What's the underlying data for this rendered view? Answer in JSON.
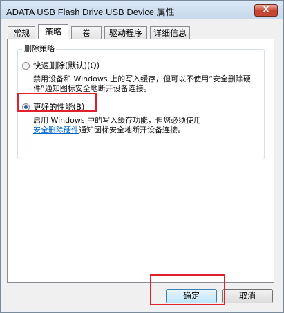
{
  "window": {
    "title": "ADATA USB Flash Drive USB Device 属性",
    "close_label": "X"
  },
  "tabs": [
    {
      "label": "常规",
      "active": false
    },
    {
      "label": "策略",
      "active": true
    },
    {
      "label": "卷",
      "active": false
    },
    {
      "label": "驱动程序",
      "active": false
    },
    {
      "label": "详细信息",
      "active": false
    }
  ],
  "removal_policy": {
    "group_title": "删除策略",
    "quick_removal": {
      "label": "快速删除(默认)(Q)",
      "description": "禁用设备和 Windows 上的写入缓存，但可以不使用“安全删除硬件”通知图标安全地断开设备连接。",
      "selected": false
    },
    "better_performance": {
      "label": "更好的性能(B)",
      "description_before": "启用 Windows 中的写入缓存功能，但您必须使用",
      "link_text": "安全删除硬件",
      "description_after": "通知图标安全地断开设备连接。",
      "selected": true
    }
  },
  "buttons": {
    "ok_label": "确定",
    "cancel_label": "取消"
  },
  "colors": {
    "highlight": "#e0202a",
    "link": "#0066cc",
    "radio_selected": "#2a5a9a"
  }
}
